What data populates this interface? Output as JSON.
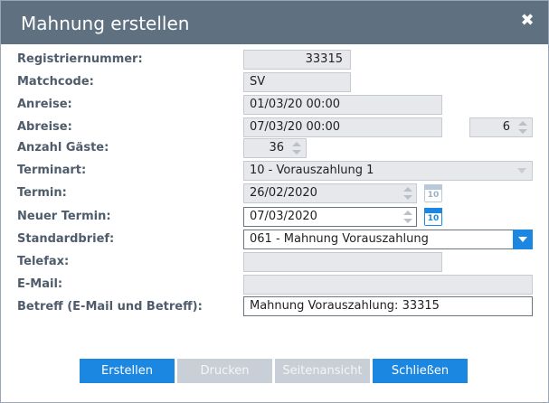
{
  "dialog": {
    "title": "Mahnung erstellen",
    "close_symbol": "✖"
  },
  "labels": {
    "registriernummer": "Registriernummer:",
    "matchcode": "Matchcode:",
    "anreise": "Anreise:",
    "abreise": "Abreise:",
    "anzahl_gaeste": "Anzahl Gäste:",
    "terminart": "Terminart:",
    "termin": "Termin:",
    "neuer_termin": "Neuer Termin:",
    "standardbrief": "Standardbrief:",
    "telefax": "Telefax:",
    "email": "E-Mail:",
    "betreff": "Betreff (E-Mail und Betreff):"
  },
  "fields": {
    "registriernummer": "33315",
    "matchcode": "SV",
    "anreise": "01/03/20 00:00",
    "abreise": "07/03/20 00:00",
    "naechte": "6",
    "anzahl_gaeste": "36",
    "terminart": "10 - Vorauszahlung 1",
    "termin": "26/02/2020",
    "neuer_termin": "07/03/2020",
    "standardbrief": "061 - Mahnung Vorauszahlung",
    "telefax": "",
    "email": "",
    "betreff": "Mahnung Vorauszahlung: 33315"
  },
  "calendar_day": "10",
  "buttons": {
    "erstellen": "Erstellen",
    "drucken": "Drucken",
    "seitenansicht": "Seitenansicht",
    "schliessen": "Schließen"
  },
  "colors": {
    "titlebar": "#5f7080",
    "accent": "#1c87e0",
    "label": "#4e5c6b",
    "disabled_button": "#c9cfd6"
  }
}
